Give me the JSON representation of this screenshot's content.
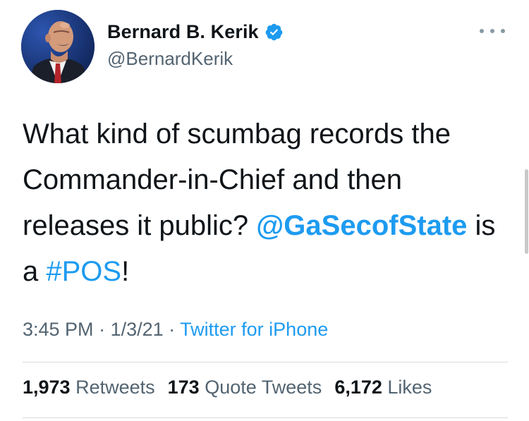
{
  "author": {
    "display_name": "Bernard B. Kerik",
    "handle": "@BernardKerik",
    "verified": true,
    "avatar_icon": "profile-photo",
    "more_icon": "more-horizontal-icon"
  },
  "tweet": {
    "text_1": "What kind of scumbag records the Commander-in-Chief and then releases it public? ",
    "mention": "@GaSecofState",
    "text_2": " is a ",
    "hashtag": "#POS",
    "text_3": "!"
  },
  "meta": {
    "time": "3:45 PM",
    "separator_1": " · ",
    "date": "1/3/21",
    "separator_2": " · ",
    "source": "Twitter for iPhone"
  },
  "stats": {
    "retweets_count": "1,973",
    "retweets_label": " Retweets",
    "quotes_count": "173",
    "quotes_label": " Quote Tweets",
    "likes_count": "6,172",
    "likes_label": " Likes"
  },
  "colors": {
    "link": "#1d9bf0",
    "text": "#0f1419",
    "muted": "#536471"
  }
}
